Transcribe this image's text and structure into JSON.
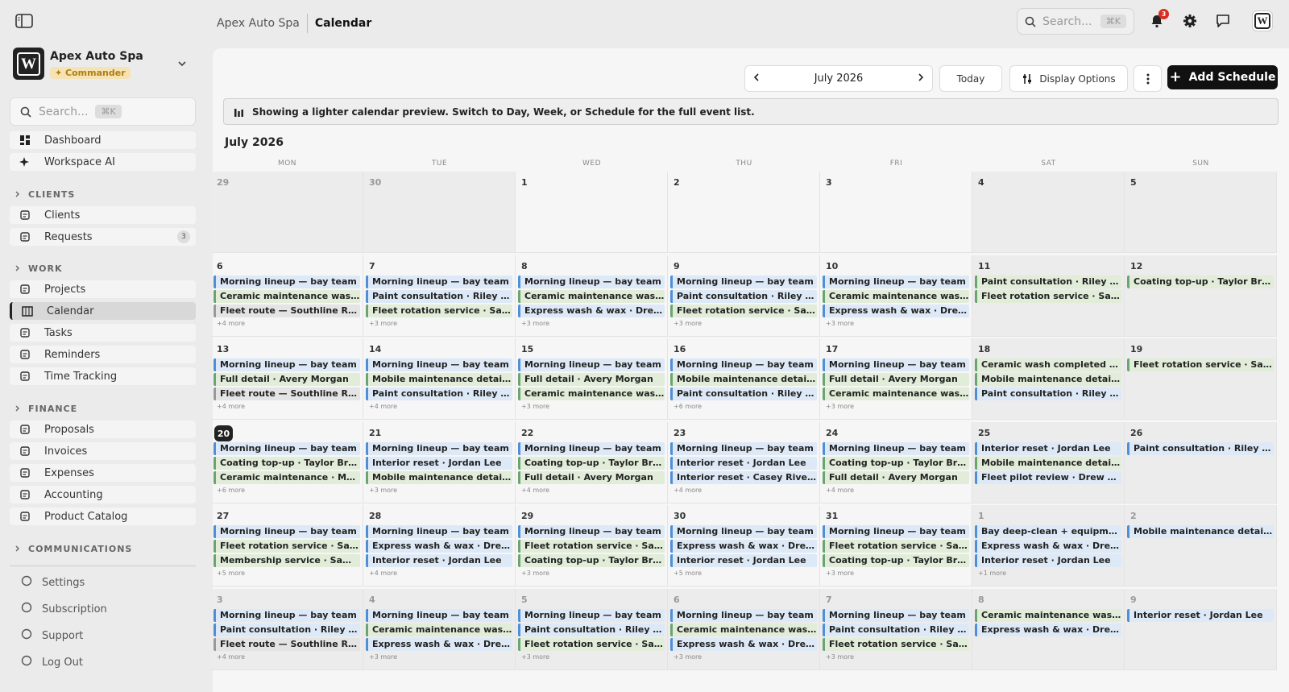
{
  "header": {
    "breadcrumb_org": "Apex Auto Spa",
    "breadcrumb_page": "Calendar",
    "search_placeholder": "Search...",
    "search_kbd": "⌘K",
    "notification_count": "3",
    "avatar_letter": "W"
  },
  "sidebar": {
    "org_name": "Apex Auto Spa",
    "org_role": "Commander",
    "org_logo_letter": "W",
    "search_placeholder": "Search...",
    "search_kbd": "⌘K",
    "items": [
      {
        "label": "Dashboard",
        "icon": "grid-icon"
      },
      {
        "label": "Workspace AI",
        "icon": "sparkle-icon"
      }
    ],
    "sections": [
      {
        "title": "CLIENTS",
        "items": [
          {
            "label": "Clients",
            "icon": "contact-icon"
          },
          {
            "label": "Requests",
            "icon": "inbox-icon",
            "badge": "3"
          }
        ]
      },
      {
        "title": "WORK",
        "items": [
          {
            "label": "Projects",
            "icon": "projects-icon"
          },
          {
            "label": "Calendar",
            "icon": "calendar-icon",
            "active": true
          },
          {
            "label": "Tasks",
            "icon": "tasks-icon"
          },
          {
            "label": "Reminders",
            "icon": "alarm-icon"
          },
          {
            "label": "Time Tracking",
            "icon": "stopwatch-icon"
          }
        ]
      },
      {
        "title": "FINANCE",
        "items": [
          {
            "label": "Proposals",
            "icon": "document-icon"
          },
          {
            "label": "Invoices",
            "icon": "invoice-icon"
          },
          {
            "label": "Expenses",
            "icon": "dollar-icon"
          },
          {
            "label": "Accounting",
            "icon": "bank-icon"
          },
          {
            "label": "Product Catalog",
            "icon": "catalog-icon"
          }
        ]
      },
      {
        "title": "COMMUNICATIONS",
        "items": []
      }
    ],
    "footer": [
      {
        "label": "Settings",
        "icon": "gear-icon"
      },
      {
        "label": "Subscription",
        "icon": "badge-icon"
      },
      {
        "label": "Support",
        "icon": "support-icon"
      },
      {
        "label": "Log Out",
        "icon": "logout-icon"
      }
    ]
  },
  "toolbar": {
    "month_label": "July 2026",
    "today_label": "Today",
    "display_options_label": "Display Options",
    "add_schedule_label": "Add Schedule"
  },
  "notice": "Showing a lighter calendar preview. Switch to Day, Week, or Schedule for the full event list.",
  "calendar": {
    "title": "July 2026",
    "weekdays": [
      "MON",
      "TUE",
      "WED",
      "THU",
      "FRI",
      "SAT",
      "SUN"
    ],
    "today": "20",
    "weeks": [
      [
        {
          "day": "29",
          "muted": true,
          "events": []
        },
        {
          "day": "30",
          "muted": true,
          "events": []
        },
        {
          "day": "1",
          "events": []
        },
        {
          "day": "2",
          "events": []
        },
        {
          "day": "3",
          "events": []
        },
        {
          "day": "4",
          "events": []
        },
        {
          "day": "5",
          "events": []
        }
      ],
      [
        {
          "day": "6",
          "events": [
            [
              "Morning lineup — bay team",
              "blue"
            ],
            [
              "Ceramic maintenance wash · Casey Rivera",
              "green"
            ],
            [
              "Fleet route — Southline Realty",
              "grey"
            ]
          ],
          "more": "+4 more"
        },
        {
          "day": "7",
          "events": [
            [
              "Morning lineup — bay team",
              "blue"
            ],
            [
              "Paint consultation · Riley Stone",
              "blue"
            ],
            [
              "Fleet rotation service · Sam Patel",
              "green"
            ]
          ],
          "more": "+3 more"
        },
        {
          "day": "8",
          "events": [
            [
              "Morning lineup — bay team",
              "blue"
            ],
            [
              "Ceramic maintenance wash · Casey Rivera",
              "green"
            ],
            [
              "Express wash & wax · Drew Walsh",
              "blue"
            ]
          ],
          "more": "+3 more"
        },
        {
          "day": "9",
          "events": [
            [
              "Morning lineup — bay team",
              "blue"
            ],
            [
              "Paint consultation · Riley Stone",
              "blue"
            ],
            [
              "Fleet rotation service · Sam Patel",
              "green"
            ]
          ],
          "more": "+3 more"
        },
        {
          "day": "10",
          "events": [
            [
              "Morning lineup — bay team",
              "blue"
            ],
            [
              "Ceramic maintenance wash · Casey Rivera",
              "green"
            ],
            [
              "Express wash & wax · Drew Walsh",
              "blue"
            ]
          ],
          "more": "+3 more"
        },
        {
          "day": "11",
          "events": [
            [
              "Paint consultation · Riley Stone",
              "green"
            ],
            [
              "Fleet rotation service · Sam Patel",
              "green"
            ]
          ]
        },
        {
          "day": "12",
          "events": [
            [
              "Coating top-up · Taylor Brooks",
              "green"
            ]
          ]
        }
      ],
      [
        {
          "day": "13",
          "events": [
            [
              "Morning lineup — bay team",
              "blue"
            ],
            [
              "Full detail · Avery Morgan",
              "green"
            ],
            [
              "Fleet route — Southline Realty",
              "grey"
            ]
          ],
          "more": "+4 more"
        },
        {
          "day": "14",
          "events": [
            [
              "Morning lineup — bay team",
              "blue"
            ],
            [
              "Mobile maintenance detail · Maya Chen",
              "green"
            ],
            [
              "Paint consultation · Riley Stone",
              "blue"
            ]
          ],
          "more": "+4 more"
        },
        {
          "day": "15",
          "events": [
            [
              "Morning lineup — bay team",
              "blue"
            ],
            [
              "Full detail · Avery Morgan",
              "green"
            ],
            [
              "Ceramic maintenance wash · Casey Rivera",
              "green"
            ]
          ],
          "more": "+3 more"
        },
        {
          "day": "16",
          "events": [
            [
              "Morning lineup — bay team",
              "blue"
            ],
            [
              "Mobile maintenance detail · Maya Chen",
              "green"
            ],
            [
              "Paint consultation · Riley Stone",
              "blue"
            ]
          ],
          "more": "+6 more"
        },
        {
          "day": "17",
          "events": [
            [
              "Morning lineup — bay team",
              "blue"
            ],
            [
              "Full detail · Avery Morgan",
              "green"
            ],
            [
              "Ceramic maintenance wash · Casey Rivera",
              "green"
            ]
          ],
          "more": "+3 more"
        },
        {
          "day": "18",
          "events": [
            [
              "Ceramic wash completed · Maya Chen",
              "green"
            ],
            [
              "Mobile maintenance detail · Maya Chen",
              "green"
            ],
            [
              "Paint consultation · Riley Stone",
              "blue"
            ]
          ]
        },
        {
          "day": "19",
          "events": [
            [
              "Fleet rotation service · Sam Patel",
              "green"
            ]
          ]
        }
      ],
      [
        {
          "day": "20",
          "today": true,
          "events": [
            [
              "Morning lineup — bay team",
              "blue"
            ],
            [
              "Coating top-up · Taylor Brooks",
              "green"
            ],
            [
              "Ceramic maintenance · Maya Chen",
              "green"
            ]
          ],
          "more": "+6 more"
        },
        {
          "day": "21",
          "events": [
            [
              "Morning lineup — bay team",
              "blue"
            ],
            [
              "Interior reset · Jordan Lee",
              "blue"
            ],
            [
              "Mobile maintenance detail · Maya Chen",
              "green"
            ]
          ],
          "more": "+3 more"
        },
        {
          "day": "22",
          "events": [
            [
              "Morning lineup — bay team",
              "blue"
            ],
            [
              "Coating top-up · Taylor Brooks",
              "green"
            ],
            [
              "Full detail · Avery Morgan",
              "green"
            ]
          ],
          "more": "+4 more"
        },
        {
          "day": "23",
          "events": [
            [
              "Morning lineup — bay team",
              "blue"
            ],
            [
              "Interior reset · Jordan Lee",
              "blue"
            ],
            [
              "Interior reset · Casey Rivera",
              "blue"
            ]
          ],
          "more": "+4 more"
        },
        {
          "day": "24",
          "events": [
            [
              "Morning lineup — bay team",
              "blue"
            ],
            [
              "Coating top-up · Taylor Brooks",
              "green"
            ],
            [
              "Full detail · Avery Morgan",
              "green"
            ]
          ],
          "more": "+4 more"
        },
        {
          "day": "25",
          "events": [
            [
              "Interior reset · Jordan Lee",
              "blue"
            ],
            [
              "Mobile maintenance detail · Maya Chen",
              "green"
            ],
            [
              "Fleet pilot review · Drew Walsh",
              "blue"
            ]
          ]
        },
        {
          "day": "26",
          "events": [
            [
              "Paint consultation · Riley Stone",
              "blue"
            ]
          ]
        }
      ],
      [
        {
          "day": "27",
          "events": [
            [
              "Morning lineup — bay team",
              "blue"
            ],
            [
              "Fleet rotation service · Sam Patel",
              "green"
            ],
            [
              "Membership service · Sam Patel",
              "green"
            ]
          ],
          "more": "+5 more"
        },
        {
          "day": "28",
          "events": [
            [
              "Morning lineup — bay team",
              "blue"
            ],
            [
              "Express wash & wax · Drew Walsh",
              "blue"
            ],
            [
              "Interior reset · Jordan Lee",
              "blue"
            ]
          ],
          "more": "+4 more"
        },
        {
          "day": "29",
          "events": [
            [
              "Morning lineup — bay team",
              "blue"
            ],
            [
              "Fleet rotation service · Sam Patel",
              "green"
            ],
            [
              "Coating top-up · Taylor Brooks",
              "green"
            ]
          ],
          "more": "+3 more"
        },
        {
          "day": "30",
          "events": [
            [
              "Morning lineup — bay team",
              "blue"
            ],
            [
              "Express wash & wax · Drew Walsh",
              "blue"
            ],
            [
              "Interior reset · Jordan Lee",
              "blue"
            ]
          ],
          "more": "+5 more"
        },
        {
          "day": "31",
          "events": [
            [
              "Morning lineup — bay team",
              "blue"
            ],
            [
              "Fleet rotation service · Sam Patel",
              "green"
            ],
            [
              "Coating top-up · Taylor Brooks",
              "green"
            ]
          ],
          "more": "+3 more"
        },
        {
          "day": "1",
          "muted": true,
          "events": [
            [
              "Bay deep-clean + equipment audit",
              "blue"
            ],
            [
              "Express wash & wax · Drew Walsh",
              "blue"
            ],
            [
              "Interior reset · Jordan Lee",
              "blue"
            ]
          ],
          "more": "+1 more"
        },
        {
          "day": "2",
          "muted": true,
          "events": [
            [
              "Mobile maintenance detail · Maya Chen",
              "blue"
            ]
          ]
        }
      ],
      [
        {
          "day": "3",
          "muted": true,
          "events": [
            [
              "Morning lineup — bay team",
              "blue"
            ],
            [
              "Paint consultation · Riley Stone",
              "blue"
            ],
            [
              "Fleet route — Southline Realty",
              "grey"
            ]
          ],
          "more": "+4 more"
        },
        {
          "day": "4",
          "muted": true,
          "events": [
            [
              "Morning lineup — bay team",
              "blue"
            ],
            [
              "Ceramic maintenance wash · Casey Rivera",
              "green"
            ],
            [
              "Express wash & wax · Drew Walsh",
              "blue"
            ]
          ],
          "more": "+3 more"
        },
        {
          "day": "5",
          "muted": true,
          "events": [
            [
              "Morning lineup — bay team",
              "blue"
            ],
            [
              "Paint consultation · Riley Stone",
              "blue"
            ],
            [
              "Fleet rotation service · Sam Patel",
              "green"
            ]
          ],
          "more": "+3 more"
        },
        {
          "day": "6",
          "muted": true,
          "events": [
            [
              "Morning lineup — bay team",
              "blue"
            ],
            [
              "Ceramic maintenance wash · Casey Rivera",
              "green"
            ],
            [
              "Express wash & wax · Drew Walsh",
              "blue"
            ]
          ],
          "more": "+3 more"
        },
        {
          "day": "7",
          "muted": true,
          "events": [
            [
              "Morning lineup — bay team",
              "blue"
            ],
            [
              "Paint consultation · Riley Stone",
              "blue"
            ],
            [
              "Fleet rotation service · Sam Patel",
              "green"
            ]
          ],
          "more": "+3 more"
        },
        {
          "day": "8",
          "muted": true,
          "events": [
            [
              "Ceramic maintenance wash · Casey Rivera",
              "green"
            ],
            [
              "Express wash & wax · Drew Walsh",
              "blue"
            ]
          ]
        },
        {
          "day": "9",
          "muted": true,
          "events": [
            [
              "Interior reset · Jordan Lee",
              "blue"
            ]
          ]
        }
      ]
    ]
  }
}
